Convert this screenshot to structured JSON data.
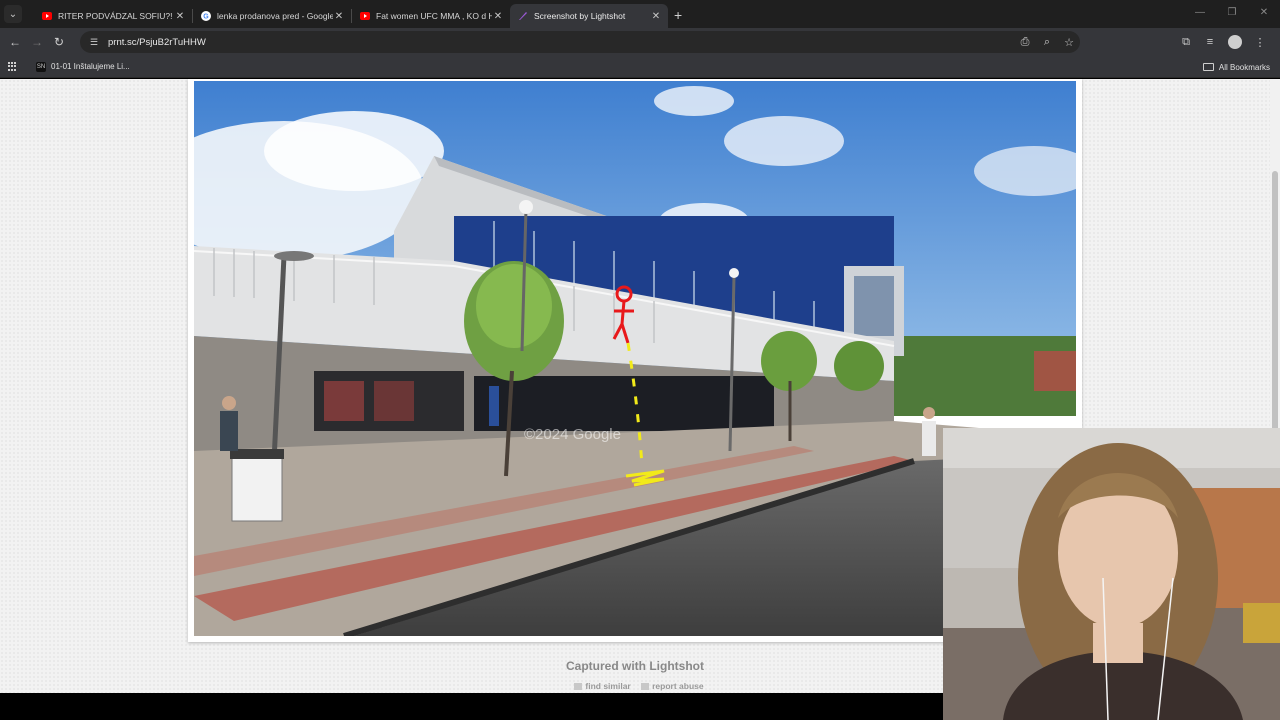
{
  "browser": {
    "tabs": [
      {
        "title": "RITER PODVÁDZAL SOFIU?! - Yo",
        "icon": "youtube-icon",
        "active": false
      },
      {
        "title": "lenka prodanova pred - Google",
        "icon": "google-icon",
        "active": false
      },
      {
        "title": "Fat women UFC MMA , KO d Hu",
        "icon": "youtube-icon",
        "active": false
      },
      {
        "title": "Screenshot by Lightshot",
        "icon": "lightshot-icon",
        "active": true
      }
    ],
    "url": "prnt.sc/PsjuB2rTuHHW",
    "bookmarks": [
      {
        "label": "01-01 Inštalujeme Li...",
        "icon_text": "SN"
      }
    ],
    "all_bookmarks_label": "All Bookmarks"
  },
  "page": {
    "watermark": "©2024 Google",
    "captured_label": "Captured with Lightshot",
    "find_similar_label": "find similar",
    "report_abuse_label": "report abuse"
  },
  "colors": {
    "tabbar": "#1f1f1f",
    "toolbar": "#35363a",
    "youtube_red": "#ff0000",
    "lightshot_purple": "#9b59d6"
  }
}
